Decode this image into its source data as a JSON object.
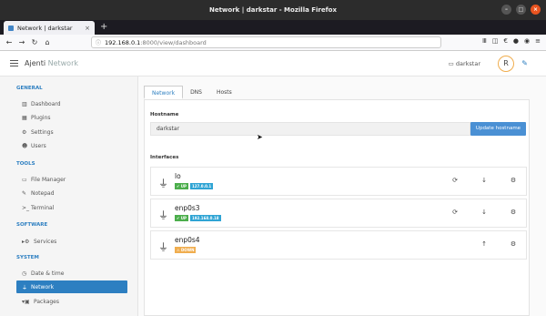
{
  "browser": {
    "window_title": "Network | darkstar - Mozilla Firefox",
    "tab_title": "Network | darkstar",
    "url_host": "192.168.0.1",
    "url_rest": ":8000/view/dashboard"
  },
  "app": {
    "brand": "Ajenti",
    "brand_sub": "Network",
    "hostname_label": "darkstar",
    "avatar_letter": "R"
  },
  "sidebar": {
    "sections": [
      {
        "title": "GENERAL",
        "items": [
          {
            "label": "Dashboard",
            "icon": "chart-icon"
          },
          {
            "label": "Plugins",
            "icon": "grid-icon"
          },
          {
            "label": "Settings",
            "icon": "gear-icon"
          },
          {
            "label": "Users",
            "icon": "users-icon"
          }
        ]
      },
      {
        "title": "TOOLS",
        "items": [
          {
            "label": "File Manager",
            "icon": "folder-icon"
          },
          {
            "label": "Notepad",
            "icon": "pencil-icon"
          },
          {
            "label": "Terminal",
            "icon": "terminal-icon"
          }
        ]
      },
      {
        "title": "SOFTWARE",
        "items": [
          {
            "label": "Services",
            "icon": "gears-icon"
          }
        ]
      },
      {
        "title": "SYSTEM",
        "items": [
          {
            "label": "Date & time",
            "icon": "clock-icon"
          },
          {
            "label": "Network",
            "icon": "plug-icon"
          },
          {
            "label": "Packages",
            "icon": "packages-icon"
          }
        ]
      }
    ]
  },
  "content": {
    "tabs": [
      "Network",
      "DNS",
      "Hosts"
    ],
    "hostname_heading": "Hostname",
    "hostname_value": "darkstar",
    "update_button": "Update hostname",
    "interfaces_heading": "Interfaces",
    "interfaces": [
      {
        "name": "lo",
        "status": "UP",
        "ip": "127.0.0.1"
      },
      {
        "name": "enp0s3",
        "status": "UP",
        "ip": "192.168.0.18"
      },
      {
        "name": "enp0s4",
        "status": "DOWN",
        "ip": ""
      }
    ]
  },
  "colors": {
    "accent": "#2d7fc1",
    "up": "#4cae4c",
    "down": "#f0ad4e",
    "ip": "#2fa4d4"
  }
}
